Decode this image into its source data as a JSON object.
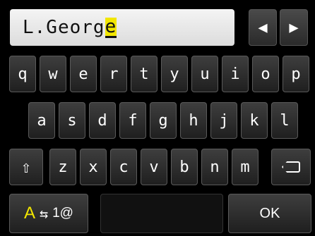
{
  "input": {
    "text": "L.Georg",
    "cursor_char": "e"
  },
  "nav": {
    "left_arrow": "◀",
    "right_arrow": "▶"
  },
  "keyboard": {
    "row1": [
      "q",
      "w",
      "e",
      "r",
      "t",
      "y",
      "u",
      "i",
      "o",
      "p"
    ],
    "row2": [
      "a",
      "s",
      "d",
      "f",
      "g",
      "h",
      "j",
      "k",
      "l"
    ],
    "row3": [
      "z",
      "x",
      "c",
      "v",
      "b",
      "n",
      "m"
    ]
  },
  "keys": {
    "shift_icon": "⇧",
    "mode_upper": "A",
    "mode_swap": "⇆",
    "mode_number": "1@",
    "ok_label": "OK"
  },
  "colors": {
    "accent": "#f2e600",
    "background": "#000000",
    "key": "#2e2e2e"
  }
}
